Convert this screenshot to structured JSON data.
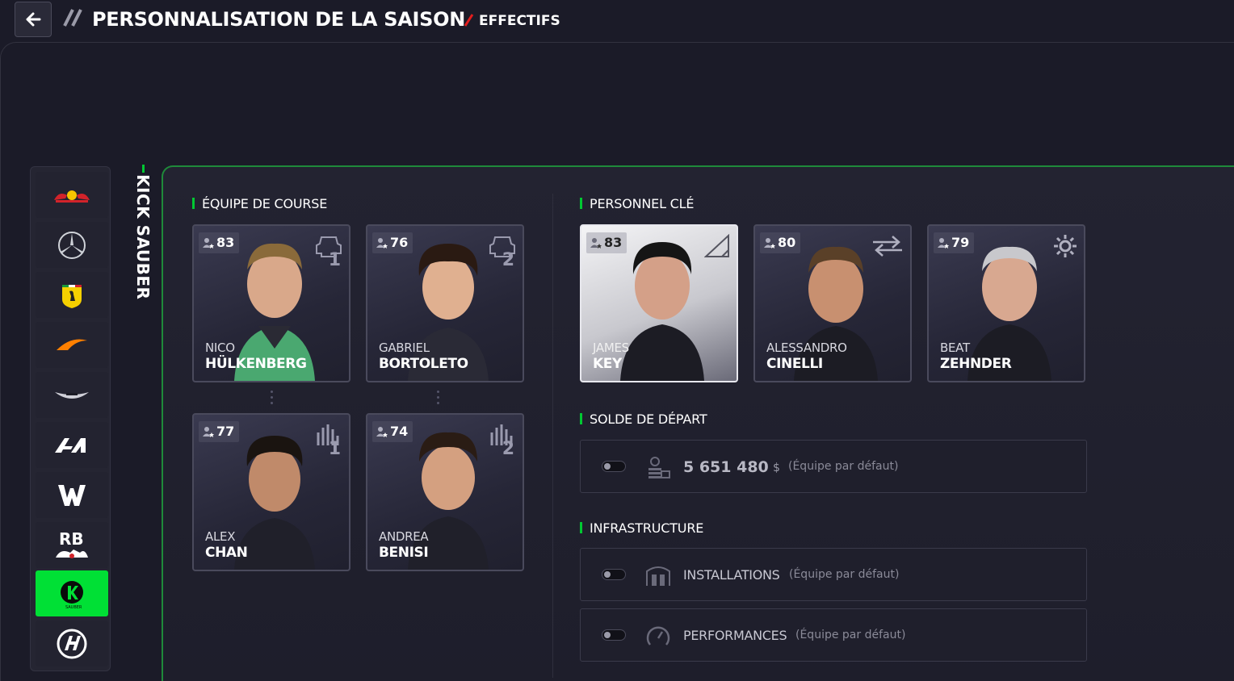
{
  "header": {
    "title": "PERSONNALISATION DE LA SAISON",
    "subtitle": "EFFECTIFS"
  },
  "teams": [
    {
      "name": "Red Bull",
      "icon": "red-bull-logo",
      "color": "#d22"
    },
    {
      "name": "Mercedes",
      "icon": "mercedes-logo",
      "color": "#cfd2d8"
    },
    {
      "name": "Ferrari",
      "icon": "ferrari-logo",
      "color": "#f5d000"
    },
    {
      "name": "McLaren",
      "icon": "mclaren-logo",
      "color": "#ff8000"
    },
    {
      "name": "Aston Martin",
      "icon": "aston-martin-logo",
      "color": "#d0d0d8"
    },
    {
      "name": "Alpine",
      "icon": "alpine-logo",
      "color": "#ffffff"
    },
    {
      "name": "Williams",
      "icon": "williams-logo",
      "color": "#ffffff"
    },
    {
      "name": "RB",
      "icon": "rb-logo",
      "color": "#ffffff"
    },
    {
      "name": "Kick Sauber",
      "icon": "kick-sauber-logo",
      "color": "#00e035",
      "active": true
    },
    {
      "name": "Haas",
      "icon": "haas-logo",
      "color": "#ffffff"
    }
  ],
  "selected_team": "KICK SAUBER",
  "race_team": {
    "title": "ÉQUIPE DE COURSE",
    "drivers": [
      {
        "rating": "83",
        "first": "NICO",
        "last": "HÜLKENBERG",
        "number": "1",
        "role_icon": "race-car-icon"
      },
      {
        "rating": "76",
        "first": "GABRIEL",
        "last": "BORTOLETO",
        "number": "2",
        "role_icon": "race-car-icon"
      },
      {
        "rating": "77",
        "first": "ALEX",
        "last": "CHAN",
        "number": "1",
        "role_icon": "pit-crew-icon"
      },
      {
        "rating": "74",
        "first": "ANDREA",
        "last": "BENISI",
        "number": "2",
        "role_icon": "pit-crew-icon"
      }
    ]
  },
  "key_staff": {
    "title": "PERSONNEL CLÉ",
    "members": [
      {
        "rating": "83",
        "first": "JAMES",
        "last": "KEY",
        "role_icon": "design-ruler-icon",
        "selected": true
      },
      {
        "rating": "80",
        "first": "ALESSANDRO",
        "last": "CINELLI",
        "role_icon": "transfer-arrows-icon"
      },
      {
        "rating": "79",
        "first": "BEAT",
        "last": "ZEHNDER",
        "role_icon": "gear-icon"
      }
    ]
  },
  "starting_balance": {
    "title": "SOLDE DE DÉPART",
    "value": "5 651 480",
    "unit": "$",
    "note": "(Équipe par défaut)"
  },
  "infrastructure": {
    "title": "INFRASTRUCTURE",
    "rows": [
      {
        "label": "INSTALLATIONS",
        "note": "(Équipe par défaut)"
      },
      {
        "label": "PERFORMANCES",
        "note": "(Équipe par défaut)"
      }
    ]
  }
}
